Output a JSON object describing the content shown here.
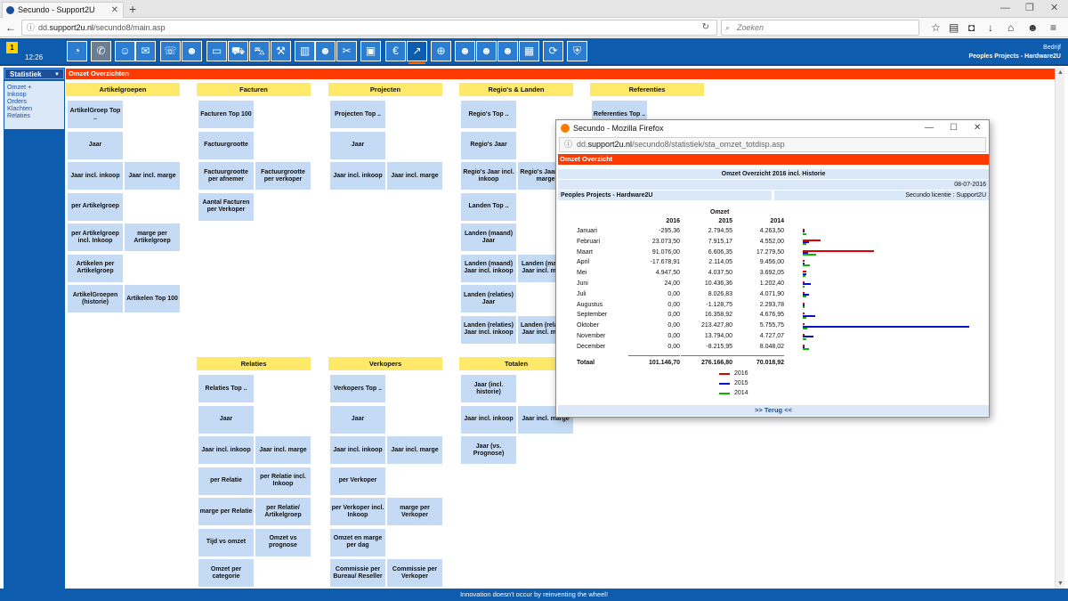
{
  "browser": {
    "tab_title": "Secundo - Support2U",
    "url_prefix": "dd.",
    "url_host": "support2u.nl",
    "url_path": "/secundo8/main.asp",
    "search_placeholder": "Zoeken"
  },
  "appbar": {
    "badge": "1",
    "clock": "12:26",
    "company_label": "Bedrijf",
    "company_name": "Peoples Projects - Hardware2U"
  },
  "sidebar": {
    "header": "Statistiek",
    "items": [
      "Omzet +",
      "Inkoop",
      "Orders",
      "Klachten",
      "Relaties"
    ]
  },
  "main": {
    "header": "Omzet Overzichten",
    "categories": [
      {
        "title": "Artikelgroepen",
        "buttons": [
          "ArtikelGroep Top ..",
          "Jaar",
          "Jaar incl. inkoop",
          "Jaar incl. marge",
          "per Artikelgroep",
          "per Artikelgroep incl. Inkoop",
          "marge per Artikelgroep",
          "Artikelen per Artikelgroep",
          "ArtikelGroepen (historie)",
          "Artikelen Top 100"
        ]
      },
      {
        "title": "Facturen",
        "buttons": [
          "Facturen Top 100",
          "Factuurgrootte",
          "Factuurgrootte per afnemer",
          "Factuurgrootte per verkoper",
          "Aantal Facturen per Verkoper"
        ]
      },
      {
        "title": "Projecten",
        "buttons": [
          "Projecten Top ..",
          "Jaar",
          "Jaar incl. inkoop",
          "Jaar incl. marge"
        ]
      },
      {
        "title": "Regio's & Landen",
        "buttons": [
          "Regio's Top ..",
          "Regio's Jaar",
          "Regio's Jaar incl. inkoop",
          "Regio's Jaar incl. marge",
          "Landen Top ..",
          "Landen (maand) Jaar",
          "Landen (maand) Jaar incl. inkoop",
          "Landen (maand) Jaar incl. marge",
          "Landen (relaties) Jaar",
          "Landen (relaties) Jaar incl. inkoop",
          "Landen (relaties) Jaar incl. marge"
        ]
      },
      {
        "title": "Referenties",
        "buttons": [
          "Referenties Top .."
        ]
      },
      {
        "title": "Relaties",
        "buttons": [
          "Relaties Top ..",
          "Jaar",
          "Jaar incl. inkoop",
          "Jaar incl. marge",
          "per Relatie",
          "per Relatie incl. Inkoop",
          "marge per Relatie",
          "per Relatie/ Artikelgroep",
          "Tijd vs omzet",
          "Omzet vs prognose",
          "Omzet per categorie"
        ]
      },
      {
        "title": "Verkopers",
        "buttons": [
          "Verkopers Top ..",
          "Jaar",
          "Jaar incl. inkoop",
          "Jaar incl. marge",
          "per Verkoper",
          "per Verkoper incl. Inkoop",
          "marge per Verkoper",
          "Omzet en marge per dag",
          "Commissie per Bureau/ Reseller",
          "Commissie per Verkoper"
        ]
      },
      {
        "title": "Totalen",
        "buttons": [
          "Jaar (incl. historie)",
          "Jaar incl. inkoop",
          "Jaar incl. marge",
          "Jaar (vs. Prognose)"
        ]
      }
    ]
  },
  "footer": "Innovation doesn't occur by reinventing the wheel!",
  "popup": {
    "window_title": "Secundo - Mozilla Firefox",
    "url_prefix": "dd.",
    "url_host": "support2u.nl",
    "url_path": "/secundo8/statistiek/sta_omzet_totdisp.asp",
    "header": "Omzet Overzicht",
    "report_title": "Omzet Overzicht 2016 incl. Historie",
    "date": "08-07-2016",
    "company": "Peoples Projects - Hardware2U",
    "license": "Secundo licentie : Support2U",
    "omzet_label": "Omzet",
    "back_link": ">> Terug <<",
    "total_label": "Totaal",
    "colors": {
      "2016": "#e00000",
      "2015": "#0a12c8",
      "2014": "#12b400"
    }
  },
  "chart_data": {
    "type": "table",
    "title": "Omzet Overzicht 2016 incl. Historie",
    "years": [
      "2016",
      "2015",
      "2014"
    ],
    "rows": [
      {
        "month": "Januari",
        "2016": "-295,36",
        "2015": "2.794,55",
        "2014": "4.263,50",
        "v2016": -295.36,
        "v2015": 2794.55,
        "v2014": 4263.5
      },
      {
        "month": "Februari",
        "2016": "23.073,50",
        "2015": "7.915,17",
        "2014": "4.552,00",
        "v2016": 23073.5,
        "v2015": 7915.17,
        "v2014": 4552.0
      },
      {
        "month": "Maart",
        "2016": "91.076,00",
        "2015": "6.606,35",
        "2014": "17.279,50",
        "v2016": 91076.0,
        "v2015": 6606.35,
        "v2014": 17279.5
      },
      {
        "month": "April",
        "2016": "-17.678,91",
        "2015": "2.114,05",
        "2014": "9.456,00",
        "v2016": -17678.91,
        "v2015": 2114.05,
        "v2014": 9456.0
      },
      {
        "month": "Mei",
        "2016": "4.947,50",
        "2015": "4.037,50",
        "2014": "3.692,05",
        "v2016": 4947.5,
        "v2015": 4037.5,
        "v2014": 3692.05
      },
      {
        "month": "Juni",
        "2016": "24,00",
        "2015": "10.436,36",
        "2014": "1.202,40",
        "v2016": 24.0,
        "v2015": 10436.36,
        "v2014": 1202.4
      },
      {
        "month": "Juli",
        "2016": "0,00",
        "2015": "8.026,83",
        "2014": "4.071,90",
        "v2016": 0,
        "v2015": 8026.83,
        "v2014": 4071.9
      },
      {
        "month": "Augustus",
        "2016": "0,00",
        "2015": "-1.128,75",
        "2014": "2.293,78",
        "v2016": 0,
        "v2015": -1128.75,
        "v2014": 2293.78
      },
      {
        "month": "September",
        "2016": "0,00",
        "2015": "16.358,92",
        "2014": "4.676,95",
        "v2016": 0,
        "v2015": 16358.92,
        "v2014": 4676.95
      },
      {
        "month": "Oktober",
        "2016": "0,00",
        "2015": "213.427,80",
        "2014": "5.755,75",
        "v2016": 0,
        "v2015": 213427.8,
        "v2014": 5755.75
      },
      {
        "month": "November",
        "2016": "0,00",
        "2015": "13.794,00",
        "2014": "4.727,07",
        "v2016": 0,
        "v2015": 13794.0,
        "v2014": 4727.07
      },
      {
        "month": "December",
        "2016": "0,00",
        "2015": "-8.215,95",
        "2014": "8.048,02",
        "v2016": 0,
        "v2015": -8215.95,
        "v2014": 8048.02
      }
    ],
    "totals": {
      "2016": "101.146,70",
      "2015": "276.166,80",
      "2014": "70.018,92"
    },
    "legend": [
      "2016",
      "2015",
      "2014"
    ]
  }
}
